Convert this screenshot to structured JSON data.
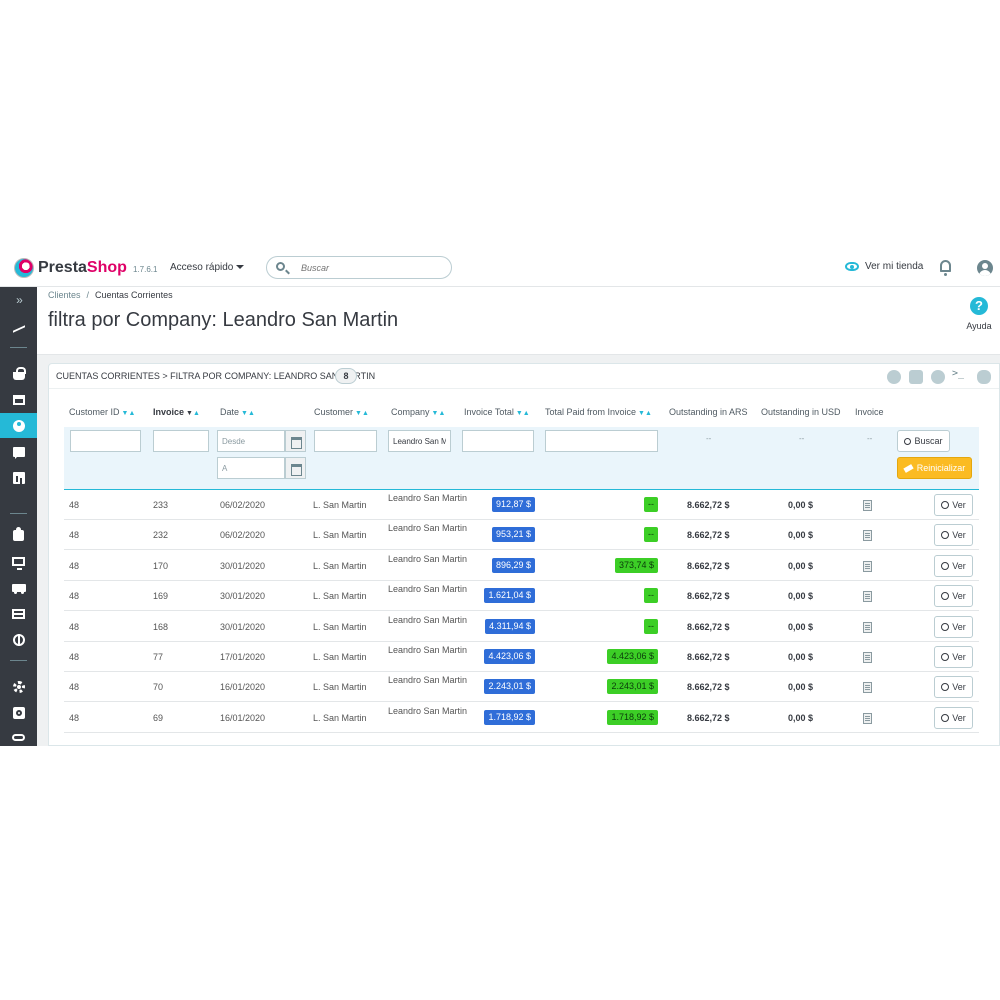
{
  "header": {
    "brand_a": "Presta",
    "brand_b": "Shop",
    "version": "1.7.6.1",
    "quick_access": "Acceso rápido",
    "search_placeholder": "Buscar",
    "view_store": "Ver mi tienda"
  },
  "breadcrumb": {
    "parent": "Clientes",
    "current": "Cuentas Corrientes"
  },
  "page_title": "filtra por Company: Leandro San Martin",
  "help_label": "Ayuda",
  "panel": {
    "title": "CUENTAS CORRIENTES > FILTRA POR COMPANY: LEANDRO SAN MARTIN",
    "count": "8"
  },
  "columns": {
    "customer_id": "Customer ID",
    "invoice": "Invoice",
    "date": "Date",
    "customer": "Customer",
    "company": "Company",
    "invoice_total": "Invoice Total",
    "total_paid": "Total Paid from Invoice",
    "outstanding_ars": "Outstanding in ARS",
    "outstanding_usd": "Outstanding in USD",
    "invoice_doc": "Invoice"
  },
  "filters": {
    "date_from_placeholder": "Desde",
    "date_to_placeholder": "A",
    "company_value": "Leandro San Martin",
    "dash": "--",
    "search_button": "Buscar",
    "reset_button": "Reinicializar"
  },
  "rows": [
    {
      "customer_id": "48",
      "invoice": "233",
      "date": "06/02/2020",
      "customer": "L. San Martin",
      "company": "Leandro San Martin",
      "invoice_total": "912,87 $",
      "total_paid": "--",
      "outstanding_ars": "8.662,72 $",
      "outstanding_usd": "0,00 $",
      "action": "Ver"
    },
    {
      "customer_id": "48",
      "invoice": "232",
      "date": "06/02/2020",
      "customer": "L. San Martin",
      "company": "Leandro San Martin",
      "invoice_total": "953,21 $",
      "total_paid": "--",
      "outstanding_ars": "8.662,72 $",
      "outstanding_usd": "0,00 $",
      "action": "Ver"
    },
    {
      "customer_id": "48",
      "invoice": "170",
      "date": "30/01/2020",
      "customer": "L. San Martin",
      "company": "Leandro San Martin",
      "invoice_total": "896,29 $",
      "total_paid": "373,74 $",
      "outstanding_ars": "8.662,72 $",
      "outstanding_usd": "0,00 $",
      "action": "Ver"
    },
    {
      "customer_id": "48",
      "invoice": "169",
      "date": "30/01/2020",
      "customer": "L. San Martin",
      "company": "Leandro San Martin",
      "invoice_total": "1.621,04 $",
      "total_paid": "--",
      "outstanding_ars": "8.662,72 $",
      "outstanding_usd": "0,00 $",
      "action": "Ver"
    },
    {
      "customer_id": "48",
      "invoice": "168",
      "date": "30/01/2020",
      "customer": "L. San Martin",
      "company": "Leandro San Martin",
      "invoice_total": "4.311,94 $",
      "total_paid": "--",
      "outstanding_ars": "8.662,72 $",
      "outstanding_usd": "0,00 $",
      "action": "Ver"
    },
    {
      "customer_id": "48",
      "invoice": "77",
      "date": "17/01/2020",
      "customer": "L. San Martin",
      "company": "Leandro San Martin",
      "invoice_total": "4.423,06 $",
      "total_paid": "4.423,06 $",
      "outstanding_ars": "8.662,72 $",
      "outstanding_usd": "0,00 $",
      "action": "Ver"
    },
    {
      "customer_id": "48",
      "invoice": "70",
      "date": "16/01/2020",
      "customer": "L. San Martin",
      "company": "Leandro San Martin",
      "invoice_total": "2.243,01 $",
      "total_paid": "2.243,01 $",
      "outstanding_ars": "8.662,72 $",
      "outstanding_usd": "0,00 $",
      "action": "Ver"
    },
    {
      "customer_id": "48",
      "invoice": "69",
      "date": "16/01/2020",
      "customer": "L. San Martin",
      "company": "Leandro San Martin",
      "invoice_total": "1.718,92 $",
      "total_paid": "1.718,92 $",
      "outstanding_ars": "8.662,72 $",
      "outstanding_usd": "0,00 $",
      "action": "Ver"
    }
  ],
  "colors": {
    "accent": "#25b9d7",
    "sidebar": "#363a41",
    "total_badge": "#2f6dd8",
    "paid_badge": "#3cce26",
    "reset_button": "#fbbb22"
  }
}
